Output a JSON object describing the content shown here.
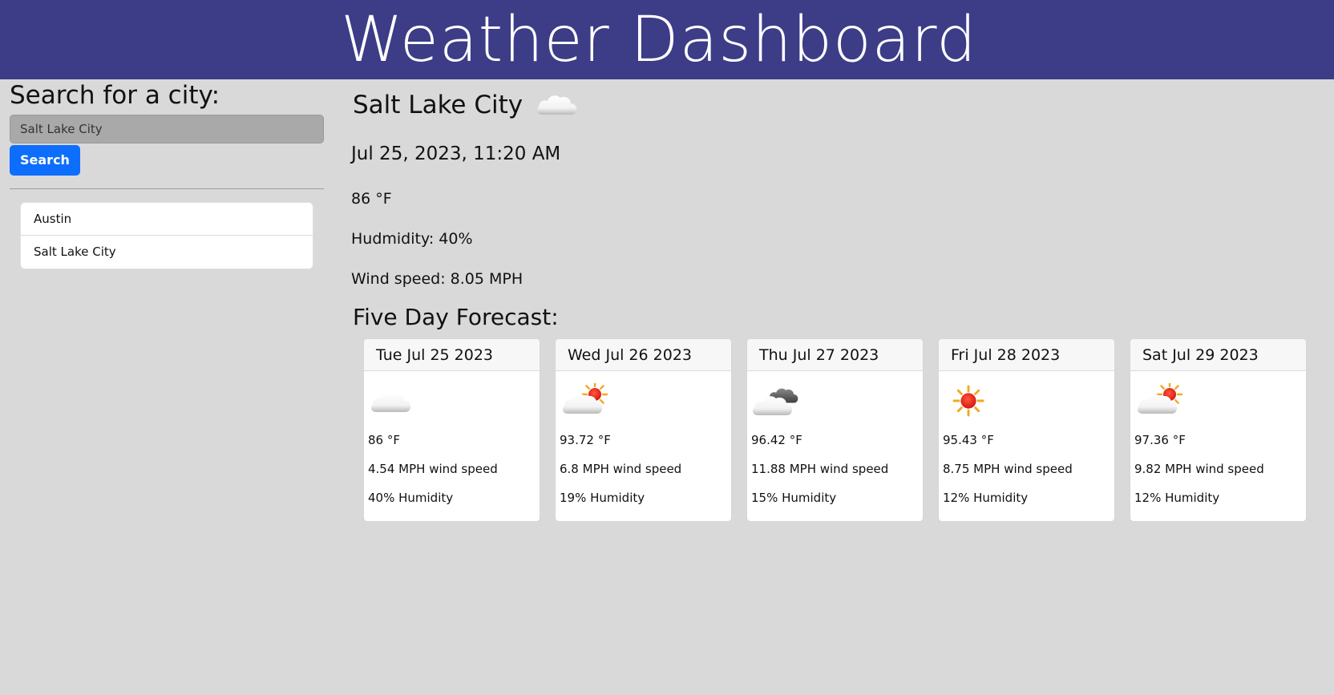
{
  "header": {
    "title": "Weather Dashboard"
  },
  "sidebar": {
    "heading": "Search for a city:",
    "search_value": "Salt Lake City",
    "search_button": "Search",
    "history": [
      "Austin",
      "Salt Lake City"
    ]
  },
  "current": {
    "city": "Salt Lake City",
    "icon": "cloud-icon",
    "datetime": "Jul 25, 2023, 11:20 AM",
    "temp": "86 °F",
    "humidity": "Hudmidity: 40%",
    "wind": "Wind speed: 8.05 MPH"
  },
  "forecast": {
    "title": "Five Day Forecast:",
    "days": [
      {
        "date": "Tue Jul 25 2023",
        "icon": "cloud-icon",
        "temp": "86 °F",
        "wind": "4.54 MPH wind speed",
        "humidity": "40% Humidity"
      },
      {
        "date": "Wed Jul 26 2023",
        "icon": "partly-sunny-icon",
        "temp": "93.72 °F",
        "wind": "6.8 MPH wind speed",
        "humidity": "19% Humidity"
      },
      {
        "date": "Thu Jul 27 2023",
        "icon": "broken-clouds-icon",
        "temp": "96.42 °F",
        "wind": "11.88 MPH wind speed",
        "humidity": "15% Humidity"
      },
      {
        "date": "Fri Jul 28 2023",
        "icon": "sun-icon",
        "temp": "95.43 °F",
        "wind": "8.75 MPH wind speed",
        "humidity": "12% Humidity"
      },
      {
        "date": "Sat Jul 29 2023",
        "icon": "partly-sunny-icon",
        "temp": "97.36 °F",
        "wind": "9.82 MPH wind speed",
        "humidity": "12% Humidity"
      }
    ]
  },
  "colors": {
    "header_bg": "#3c3c87",
    "page_bg": "#d9d9d9",
    "button": "#0d6efd",
    "sun": "#e8261b"
  }
}
